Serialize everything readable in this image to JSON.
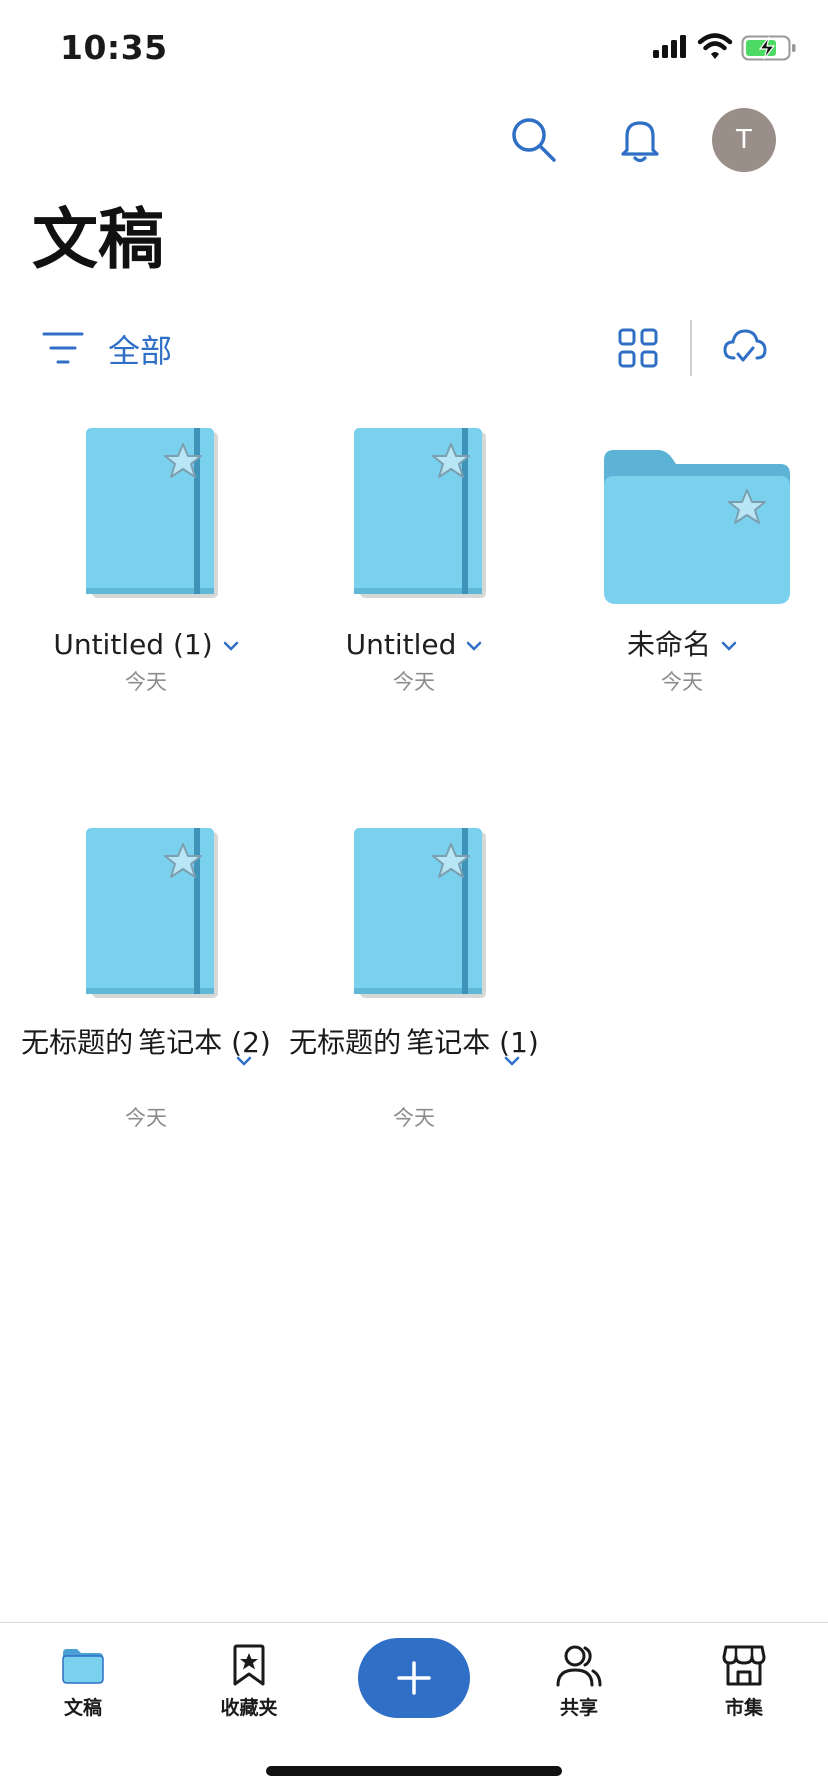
{
  "status_bar": {
    "time": "10:35"
  },
  "header": {
    "avatar_initial": "T",
    "title": "文稿"
  },
  "filter": {
    "label": "全部"
  },
  "items": [
    {
      "name": "Untitled (1)",
      "date": "今天",
      "kind": "notebook"
    },
    {
      "name": "Untitled",
      "date": "今天",
      "kind": "notebook"
    },
    {
      "name": "未命名",
      "date": "今天",
      "kind": "folder"
    },
    {
      "name_line1": "无标题的",
      "name_line2": "笔记本 (2)",
      "date": "今天",
      "kind": "notebook"
    },
    {
      "name_line1": "无标题的",
      "name_line2": "笔记本 (1)",
      "date": "今天",
      "kind": "notebook"
    }
  ],
  "tabs": [
    {
      "label": "文稿",
      "icon": "folder-icon"
    },
    {
      "label": "收藏夹",
      "icon": "bookmark-star-icon"
    },
    {
      "label": "共享",
      "icon": "people-icon"
    },
    {
      "label": "市集",
      "icon": "store-icon"
    }
  ],
  "colors": {
    "accent": "#2f6fc6",
    "notebook": "#79d1ee",
    "avatar": "#9a8f88"
  }
}
